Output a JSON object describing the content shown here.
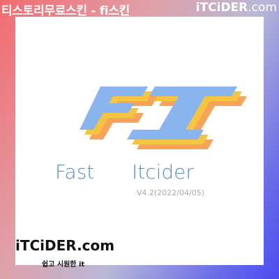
{
  "header": {
    "title": "티스토리무료스킨 - fi스킨",
    "brand_main": "iTCiDER",
    "brand_tld": ".com"
  },
  "logo": {
    "mark_text": "FI",
    "word_left": "Fast",
    "word_right": "Itcider",
    "version": "V4.2(2022/04/05)",
    "colors": {
      "front": "#8ab4ee",
      "middle": "#f5c542",
      "back": "#f7a35a",
      "wordmark": "#4f8fd0"
    }
  },
  "footer": {
    "brand_main": "iTCiDER",
    "brand_tld": ".com",
    "tagline": "쉽고 시원한 it"
  }
}
